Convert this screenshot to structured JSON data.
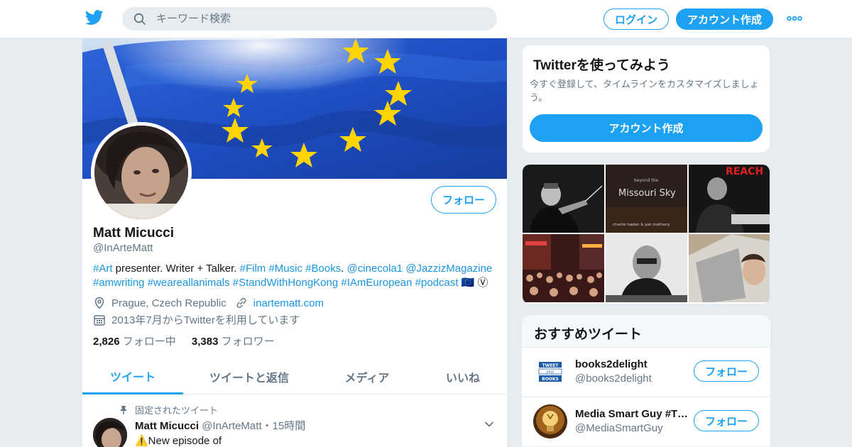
{
  "header": {
    "logo_icon": "twitter-bird-icon",
    "search_placeholder": "キーワード検索",
    "login_label": "ログイン",
    "signup_label": "アカウント作成",
    "more_icon": "more-dots-icon"
  },
  "profile": {
    "follow_label": "フォロー",
    "name": "Matt Micucci",
    "handle": "@InArteMatt",
    "bio": [
      {
        "text": "#Art",
        "link": true
      },
      {
        "text": " presenter. Writer + Talker. ",
        "link": false
      },
      {
        "text": "#Film",
        "link": true
      },
      {
        "text": " ",
        "link": false
      },
      {
        "text": "#Music",
        "link": true
      },
      {
        "text": " ",
        "link": false
      },
      {
        "text": "#Books",
        "link": true
      },
      {
        "text": ". ",
        "link": false
      },
      {
        "text": "@cinecola1",
        "link": true
      },
      {
        "text": " ",
        "link": false
      },
      {
        "text": "@JazzizMagazine",
        "link": true
      },
      {
        "text": " ",
        "link": false
      },
      {
        "text": "#amwriting",
        "link": true
      },
      {
        "text": " ",
        "link": false
      },
      {
        "text": "#weareallanimals",
        "link": true
      },
      {
        "text": " ",
        "link": false
      },
      {
        "text": "#StandWithHongKong",
        "link": true
      },
      {
        "text": " ",
        "link": false
      },
      {
        "text": "#IAmEuropean",
        "link": true
      },
      {
        "text": " ",
        "link": false
      },
      {
        "text": "#podcast",
        "link": true
      },
      {
        "text": " 🇪🇺 Ⓥ",
        "link": false
      }
    ],
    "location": "Prague, Czech Republic",
    "website": "inartematt.com",
    "joined": "2013年7月からTwitterを利用しています",
    "following_count": "2,826",
    "following_label": "フォロー中",
    "followers_count": "3,383",
    "followers_label": "フォロワー"
  },
  "tabs": [
    {
      "label": "ツイート",
      "active": true
    },
    {
      "label": "ツイートと返信",
      "active": false
    },
    {
      "label": "メディア",
      "active": false
    },
    {
      "label": "いいね",
      "active": false
    }
  ],
  "tweet": {
    "pinned_label": "固定されたツイート",
    "author_name": "Matt Micucci",
    "author_handle": "@InArteMatt",
    "separator": "・",
    "time": "15時間",
    "text": "⚠️New episode of"
  },
  "signup_card": {
    "title": "Twitterを使ってみよう",
    "description": "今すぐ登録して、タイムラインをカスタマイズしましょう。",
    "button_label": "アカウント作成"
  },
  "media_grid": {
    "tiles": [
      "conductor-photo",
      "album-cover-photo",
      "pianist-photo",
      "street-crowd-photo",
      "portrait-photo",
      "selfie-photo"
    ],
    "album_line1": "beyond the",
    "album_line2": "Missouri Sky",
    "album_line3": "charlie haden & pat metheny",
    "album_corner": "REACH"
  },
  "recommendations": {
    "title": "おすすめツイート",
    "items": [
      {
        "name": "books2delight",
        "handle": "@books2delight",
        "follow_label": "フォロー",
        "avatar_text": [
          "TWEET",
          "your",
          "BOOKS"
        ]
      },
      {
        "name": "Media Smart Guy #Ti...",
        "handle": "@MediaSmartGuy",
        "follow_label": "フォロー"
      }
    ]
  },
  "colors": {
    "accent": "#1da1f2",
    "background": "#e6ecf0",
    "text_secondary": "#657786",
    "eu_blue": "#1f4fc4",
    "eu_gold": "#ffd400"
  }
}
